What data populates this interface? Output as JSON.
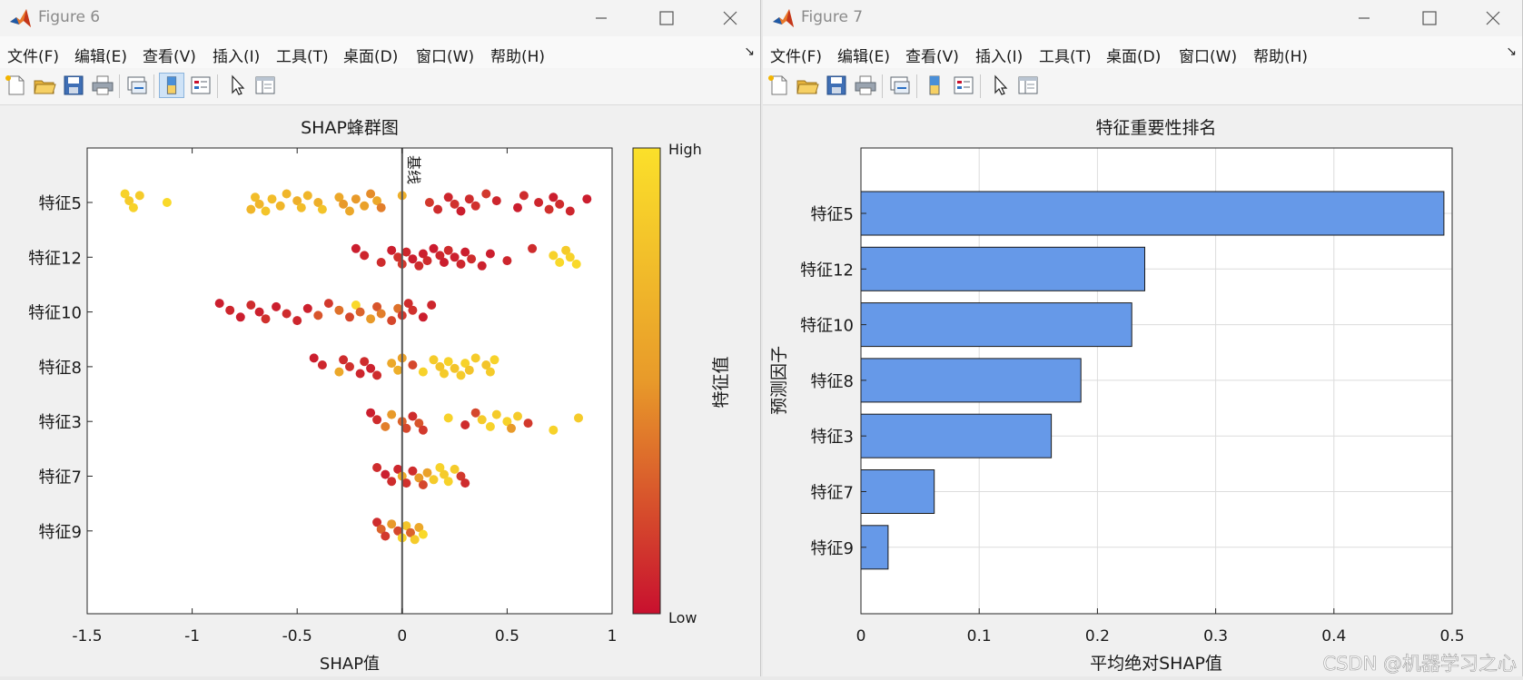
{
  "windows": [
    {
      "title": "Figure 6",
      "menu": [
        "文件(F)",
        "编辑(E)",
        "查看(V)",
        "插入(I)",
        "工具(T)",
        "桌面(D)",
        "窗口(W)",
        "帮助(H)"
      ],
      "menu_more_glyph": "↘"
    },
    {
      "title": "Figure 7",
      "menu": [
        "文件(F)",
        "编辑(E)",
        "查看(V)",
        "插入(I)",
        "工具(T)",
        "桌面(D)",
        "窗口(W)",
        "帮助(H)"
      ],
      "menu_more_glyph": "↘"
    }
  ],
  "icons": {
    "app": "matlab-logo-icon",
    "window_controls": [
      "minimize-icon",
      "maximize-icon",
      "close-icon"
    ],
    "toolbar": [
      "new-figure-icon",
      "open-file-icon",
      "save-icon",
      "print-icon",
      "link-plot-icon",
      "colorbar-toggle-icon",
      "legend-toggle-icon",
      "edit-plot-pointer-icon",
      "property-inspector-icon"
    ]
  },
  "colors": {
    "colormap_low": "#c8102e",
    "colormap_mid": "#e89a2a",
    "colormap_high": "#fbe02a",
    "bar_fill": "#6699e8",
    "baseline": "#555555"
  },
  "chart_data": [
    {
      "type": "scatter",
      "subtype": "shap-beeswarm",
      "title": "SHAP蜂群图",
      "xlabel": "SHAP值",
      "ylabel": "",
      "xlim": [
        -1.5,
        1
      ],
      "xticks": [
        -1.5,
        -1,
        -0.5,
        0,
        0.5,
        1
      ],
      "xtick_labels": [
        "-1.5",
        "-1",
        "-0.5",
        "0",
        "0.5",
        "1"
      ],
      "categories": [
        "特征5",
        "特征12",
        "特征10",
        "特征8",
        "特征3",
        "特征7",
        "特征9"
      ],
      "baseline": {
        "x": 0,
        "label": "基线"
      },
      "colorbar": {
        "label": "特征值",
        "high_label": "High",
        "low_label": "Low"
      },
      "grid": false,
      "series": [
        {
          "category": "特征5",
          "x": [
            -1.32,
            -1.3,
            -1.28,
            -1.25,
            -1.12,
            -0.72,
            -0.7,
            -0.68,
            -0.65,
            -0.62,
            -0.58,
            -0.55,
            -0.5,
            -0.48,
            -0.45,
            -0.4,
            -0.38,
            -0.3,
            -0.28,
            -0.25,
            -0.22,
            -0.18,
            -0.15,
            -0.12,
            -0.1,
            0.0,
            0.13,
            0.17,
            0.22,
            0.25,
            0.28,
            0.32,
            0.35,
            0.4,
            0.45,
            0.55,
            0.58,
            0.65,
            0.7,
            0.72,
            0.75,
            0.8,
            0.88
          ],
          "v": [
            0.9,
            0.85,
            0.9,
            0.85,
            0.95,
            0.7,
            0.75,
            0.7,
            0.8,
            0.75,
            0.7,
            0.7,
            0.65,
            0.75,
            0.7,
            0.65,
            0.8,
            0.6,
            0.5,
            0.6,
            0.5,
            0.55,
            0.45,
            0.6,
            0.4,
            0.65,
            0.15,
            0.1,
            0.08,
            0.12,
            0.05,
            0.1,
            0.12,
            0.15,
            0.08,
            0.05,
            0.1,
            0.08,
            0.12,
            0.05,
            0.1,
            0.08,
            0.05
          ]
        },
        {
          "category": "特征12",
          "x": [
            -0.22,
            -0.18,
            -0.1,
            -0.05,
            -0.02,
            0.0,
            0.02,
            0.05,
            0.08,
            0.1,
            0.12,
            0.15,
            0.18,
            0.2,
            0.22,
            0.25,
            0.28,
            0.3,
            0.33,
            0.38,
            0.42,
            0.5,
            0.62,
            0.72,
            0.75,
            0.78,
            0.8,
            0.83
          ],
          "v": [
            0.05,
            0.08,
            0.1,
            0.05,
            0.12,
            0.15,
            0.08,
            0.05,
            0.1,
            0.06,
            0.1,
            0.04,
            0.08,
            0.05,
            0.1,
            0.06,
            0.08,
            0.05,
            0.1,
            0.06,
            0.05,
            0.08,
            0.1,
            0.9,
            0.95,
            0.85,
            0.9,
            0.95
          ]
        },
        {
          "category": "特征10",
          "x": [
            -0.87,
            -0.82,
            -0.77,
            -0.72,
            -0.68,
            -0.65,
            -0.6,
            -0.55,
            -0.5,
            -0.45,
            -0.4,
            -0.35,
            -0.3,
            -0.25,
            -0.22,
            -0.2,
            -0.15,
            -0.12,
            -0.1,
            -0.05,
            -0.02,
            0.0,
            0.03,
            0.05,
            0.1,
            0.14
          ],
          "v": [
            0.05,
            0.08,
            0.05,
            0.1,
            0.06,
            0.12,
            0.05,
            0.1,
            0.08,
            0.06,
            0.25,
            0.15,
            0.35,
            0.2,
            0.95,
            0.3,
            0.5,
            0.25,
            0.4,
            0.2,
            0.35,
            0.15,
            0.1,
            0.12,
            0.05,
            0.08
          ]
        },
        {
          "category": "特征8",
          "x": [
            -0.42,
            -0.38,
            -0.3,
            -0.28,
            -0.25,
            -0.2,
            -0.18,
            -0.15,
            -0.12,
            -0.05,
            -0.02,
            0.0,
            0.05,
            0.1,
            0.15,
            0.18,
            0.2,
            0.22,
            0.25,
            0.28,
            0.3,
            0.32,
            0.35,
            0.4,
            0.42,
            0.44
          ],
          "v": [
            0.05,
            0.08,
            0.6,
            0.1,
            0.12,
            0.08,
            0.1,
            0.06,
            0.1,
            0.6,
            0.65,
            0.55,
            0.2,
            0.9,
            0.85,
            0.8,
            0.85,
            0.9,
            0.8,
            0.85,
            0.9,
            0.8,
            0.85,
            0.8,
            0.85,
            0.9
          ]
        },
        {
          "category": "特征3",
          "x": [
            -0.15,
            -0.12,
            -0.08,
            -0.05,
            0.0,
            0.02,
            0.05,
            0.08,
            0.1,
            0.22,
            0.3,
            0.35,
            0.38,
            0.42,
            0.45,
            0.5,
            0.52,
            0.55,
            0.6,
            0.72,
            0.84
          ],
          "v": [
            0.05,
            0.1,
            0.4,
            0.5,
            0.3,
            0.2,
            0.1,
            0.25,
            0.15,
            0.9,
            0.1,
            0.2,
            0.85,
            0.9,
            0.85,
            0.9,
            0.5,
            0.85,
            0.15,
            0.9,
            0.85
          ]
        },
        {
          "category": "特征7",
          "x": [
            -0.12,
            -0.08,
            -0.05,
            -0.02,
            0.0,
            0.02,
            0.05,
            0.08,
            0.1,
            0.12,
            0.15,
            0.18,
            0.2,
            0.22,
            0.25,
            0.28,
            0.3
          ],
          "v": [
            0.1,
            0.05,
            0.1,
            0.08,
            0.6,
            0.12,
            0.1,
            0.5,
            0.2,
            0.55,
            0.85,
            0.9,
            0.85,
            0.9,
            0.85,
            0.15,
            0.1
          ]
        },
        {
          "category": "特征9",
          "x": [
            -0.12,
            -0.1,
            -0.08,
            -0.05,
            -0.02,
            0.0,
            0.02,
            0.04,
            0.06,
            0.08,
            0.1
          ],
          "v": [
            0.1,
            0.3,
            0.15,
            0.5,
            0.2,
            0.9,
            0.8,
            0.3,
            0.85,
            0.6,
            0.95
          ]
        }
      ]
    },
    {
      "type": "bar",
      "orientation": "horizontal",
      "title": "特征重要性排名",
      "xlabel": "平均绝对SHAP值",
      "ylabel": "预测因子",
      "xlim": [
        0,
        0.5
      ],
      "xticks": [
        0,
        0.1,
        0.2,
        0.3,
        0.4,
        0.5
      ],
      "xtick_labels": [
        "0",
        "0.1",
        "0.2",
        "0.3",
        "0.4",
        "0.5"
      ],
      "categories": [
        "特征5",
        "特征12",
        "特征10",
        "特征8",
        "特征3",
        "特征7",
        "特征9"
      ],
      "values": [
        0.493,
        0.24,
        0.229,
        0.186,
        0.161,
        0.062,
        0.023
      ],
      "grid": true
    }
  ],
  "watermark": "CSDN @机器学习之心"
}
